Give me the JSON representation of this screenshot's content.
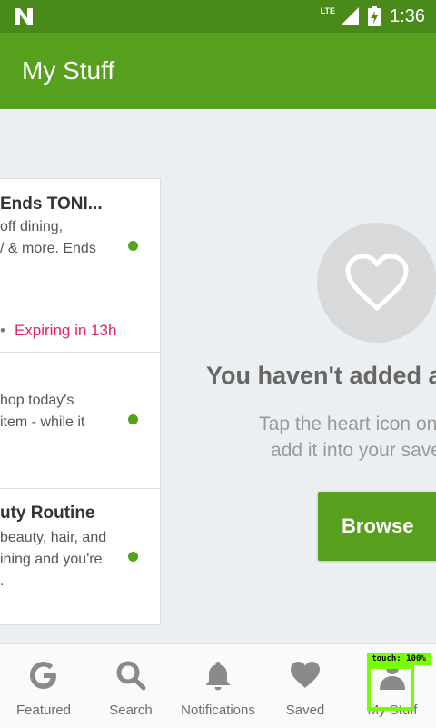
{
  "status_bar": {
    "network": "LTE",
    "time": "1:36"
  },
  "app_bar": {
    "title": "My Stuff"
  },
  "deals": [
    {
      "title": "Ends TONI...",
      "desc": [
        "off dining,",
        "/ & more. Ends"
      ],
      "expiring": "Expiring in 13h"
    },
    {
      "title": "",
      "desc": [
        "hop today's",
        " item - while it"
      ],
      "expiring": ""
    },
    {
      "title": "uty Routine",
      "desc": [
        "beauty, hair, and",
        "ining and you're",
        "."
      ],
      "expiring": ""
    }
  ],
  "empty_state": {
    "title": "You haven't added a",
    "subtitle_line1": "Tap the heart icon on a",
    "subtitle_line2": "add it into your save",
    "browse_label": "Browse"
  },
  "bottom_nav": [
    {
      "label": "Featured",
      "icon": "g-logo-icon"
    },
    {
      "label": "Search",
      "icon": "search-icon"
    },
    {
      "label": "Notifications",
      "icon": "bell-icon"
    },
    {
      "label": "Saved",
      "icon": "heart-icon"
    },
    {
      "label": "My Stuff",
      "icon": "person-icon"
    }
  ],
  "touch_indicator": {
    "label": "touch: 100%"
  },
  "colors": {
    "primary": "#56a01d",
    "primary_dark": "#4a8a1a",
    "expiring": "#e0245e",
    "touch_overlay": "#76ff03"
  }
}
